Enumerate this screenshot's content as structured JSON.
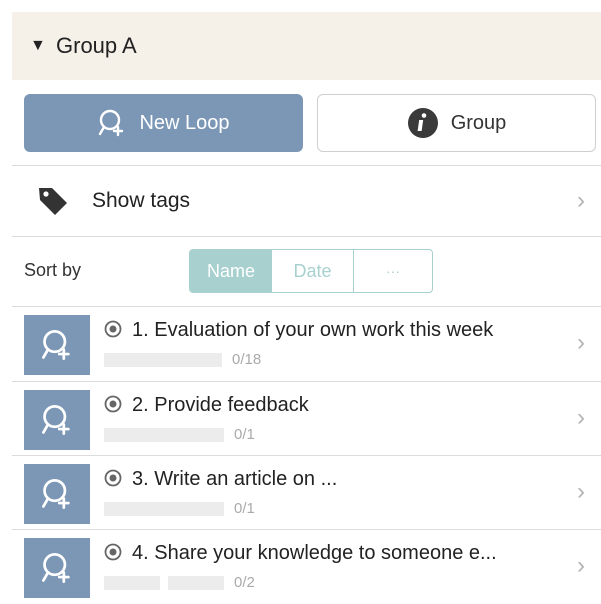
{
  "group": {
    "title": "Group A"
  },
  "actions": {
    "new_loop_label": "New Loop",
    "group_label": "Group"
  },
  "tags": {
    "label": "Show tags"
  },
  "sort": {
    "label": "Sort by",
    "options": [
      "Name",
      "Date",
      "···"
    ],
    "selected": "Name"
  },
  "loops": [
    {
      "title": "1. Evaluation of your own work this week",
      "count": "0/18"
    },
    {
      "title": "2. Provide feedback",
      "count": "0/1"
    },
    {
      "title": "3. Write an article on ...",
      "count": "0/1"
    },
    {
      "title": "4. Share your knowledge to someone e...",
      "count": "0/2"
    }
  ],
  "colors": {
    "accent": "#7b97b5",
    "sort_accent": "#a7d0cf",
    "header_bg": "#f5f0e8"
  }
}
